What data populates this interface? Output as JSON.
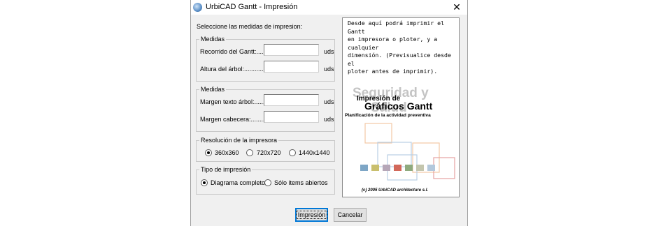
{
  "window": {
    "title": "UrbiCAD Gantt - Impresión",
    "close_glyph": "✕"
  },
  "form": {
    "heading": "Seleccione las medidas de impresion:",
    "medidas1": {
      "legend": "Medidas",
      "recorrido_label": "Recorrido del Gantt:.........",
      "recorrido_value": "",
      "recorrido_unit": "uds",
      "altura_label": "Altura del árbol:................",
      "altura_value": "",
      "altura_unit": "uds"
    },
    "medidas2": {
      "legend": "Medidas",
      "margen_texto_label": "Margen texto árbol:..........",
      "margen_texto_value": "",
      "margen_texto_unit": "uds",
      "margen_cabecera_label": "Margen cabecera:...............",
      "margen_cabecera_value": "",
      "margen_cabecera_unit": "uds"
    },
    "resolucion": {
      "legend": "Resolución de la impresora",
      "options": [
        "360x360",
        "720x720",
        "1440x1440"
      ],
      "selected": "360x360"
    },
    "tipo": {
      "legend": "Tipo de impresión",
      "options": [
        "Diagrama completo",
        "Sólo items abiertos"
      ],
      "selected": "Diagrama completo"
    }
  },
  "info_panel": {
    "description": "Desde aquí podrá imprimir el Gantt\nen impresora o ploter, y a cualquier\ndimensión. (Previsualice desde el\nploter antes de imprimir).",
    "graphic": {
      "watermark_line1": "Seguridad y",
      "watermark_line2": "Salud",
      "title_line1": "Impresión de",
      "title_line2": "Gráficos Gantt",
      "subtitle": "Planificación de la actividad preventiva",
      "copyright": "(c) 2005 UrbiCAD architecture s.l.",
      "square_colors": [
        "#7ea6c6",
        "#c9bf6e",
        "#b6a7b8",
        "#d2685a",
        "#8faa7e",
        "#c4c6ae",
        "#b3c8dc"
      ],
      "outline_colors": [
        "#f2c9a5",
        "#b9cfe4",
        "#f2c9a5",
        "#b9cfe4",
        "#e6a2a2"
      ]
    }
  },
  "buttons": {
    "print": "Impresión",
    "cancel": "Cancelar"
  }
}
